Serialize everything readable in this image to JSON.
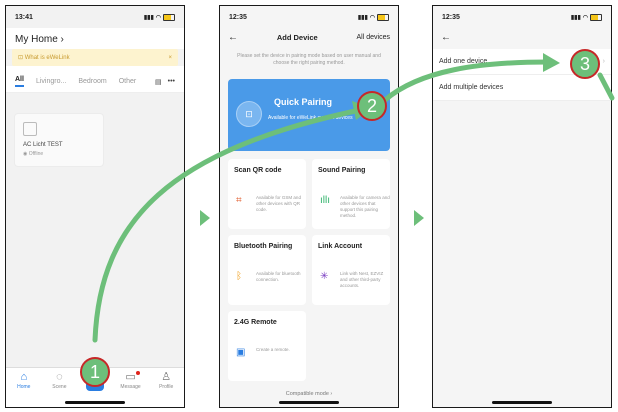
{
  "screen1": {
    "time": "13:41",
    "home_title": "My Home ›",
    "banner_text": "What is eWeLink",
    "banner_close": "×",
    "tabs": [
      "All",
      "Livingro...",
      "Bedroom",
      "Other"
    ],
    "device": {
      "name": "AC Licht TEST",
      "status": "Offline"
    },
    "nav": [
      {
        "label": "Home",
        "icon": "home-icon"
      },
      {
        "label": "Scene",
        "icon": "scene-icon"
      },
      {
        "label": "",
        "icon": "add-icon"
      },
      {
        "label": "Message",
        "icon": "message-icon"
      },
      {
        "label": "Profile",
        "icon": "profile-icon"
      }
    ]
  },
  "screen2": {
    "time": "12:35",
    "title": "Add Device",
    "all_devices": "All devices",
    "hint": "Please set the device in pairing mode based on user manual and choose the right pairing method.",
    "quick_pairing": {
      "title": "Quick Pairing",
      "subtitle": "Available for eWeLink support devices"
    },
    "cards": [
      {
        "title": "Scan QR code",
        "desc": "Available for GSM and other devices with QR code."
      },
      {
        "title": "Sound Pairing",
        "desc": "Available for camera and other devices that support this pairing method."
      },
      {
        "title": "Bluetooth Pairing",
        "desc": "Available for bluetooth connection."
      },
      {
        "title": "Link Account",
        "desc": "Link with Nest, EZVIZ and other third-party accounts."
      },
      {
        "title": "2.4G Remote",
        "desc": "Create a remote."
      }
    ],
    "footer": "Compatible mode ›"
  },
  "screen3": {
    "time": "12:35",
    "rows": [
      "Add one device",
      "Add multiple devices"
    ]
  },
  "badges": [
    "1",
    "2",
    "3"
  ],
  "colors": {
    "accent": "#2a7de1",
    "arrow": "#6dbf7a",
    "badge_border": "#c62828"
  }
}
